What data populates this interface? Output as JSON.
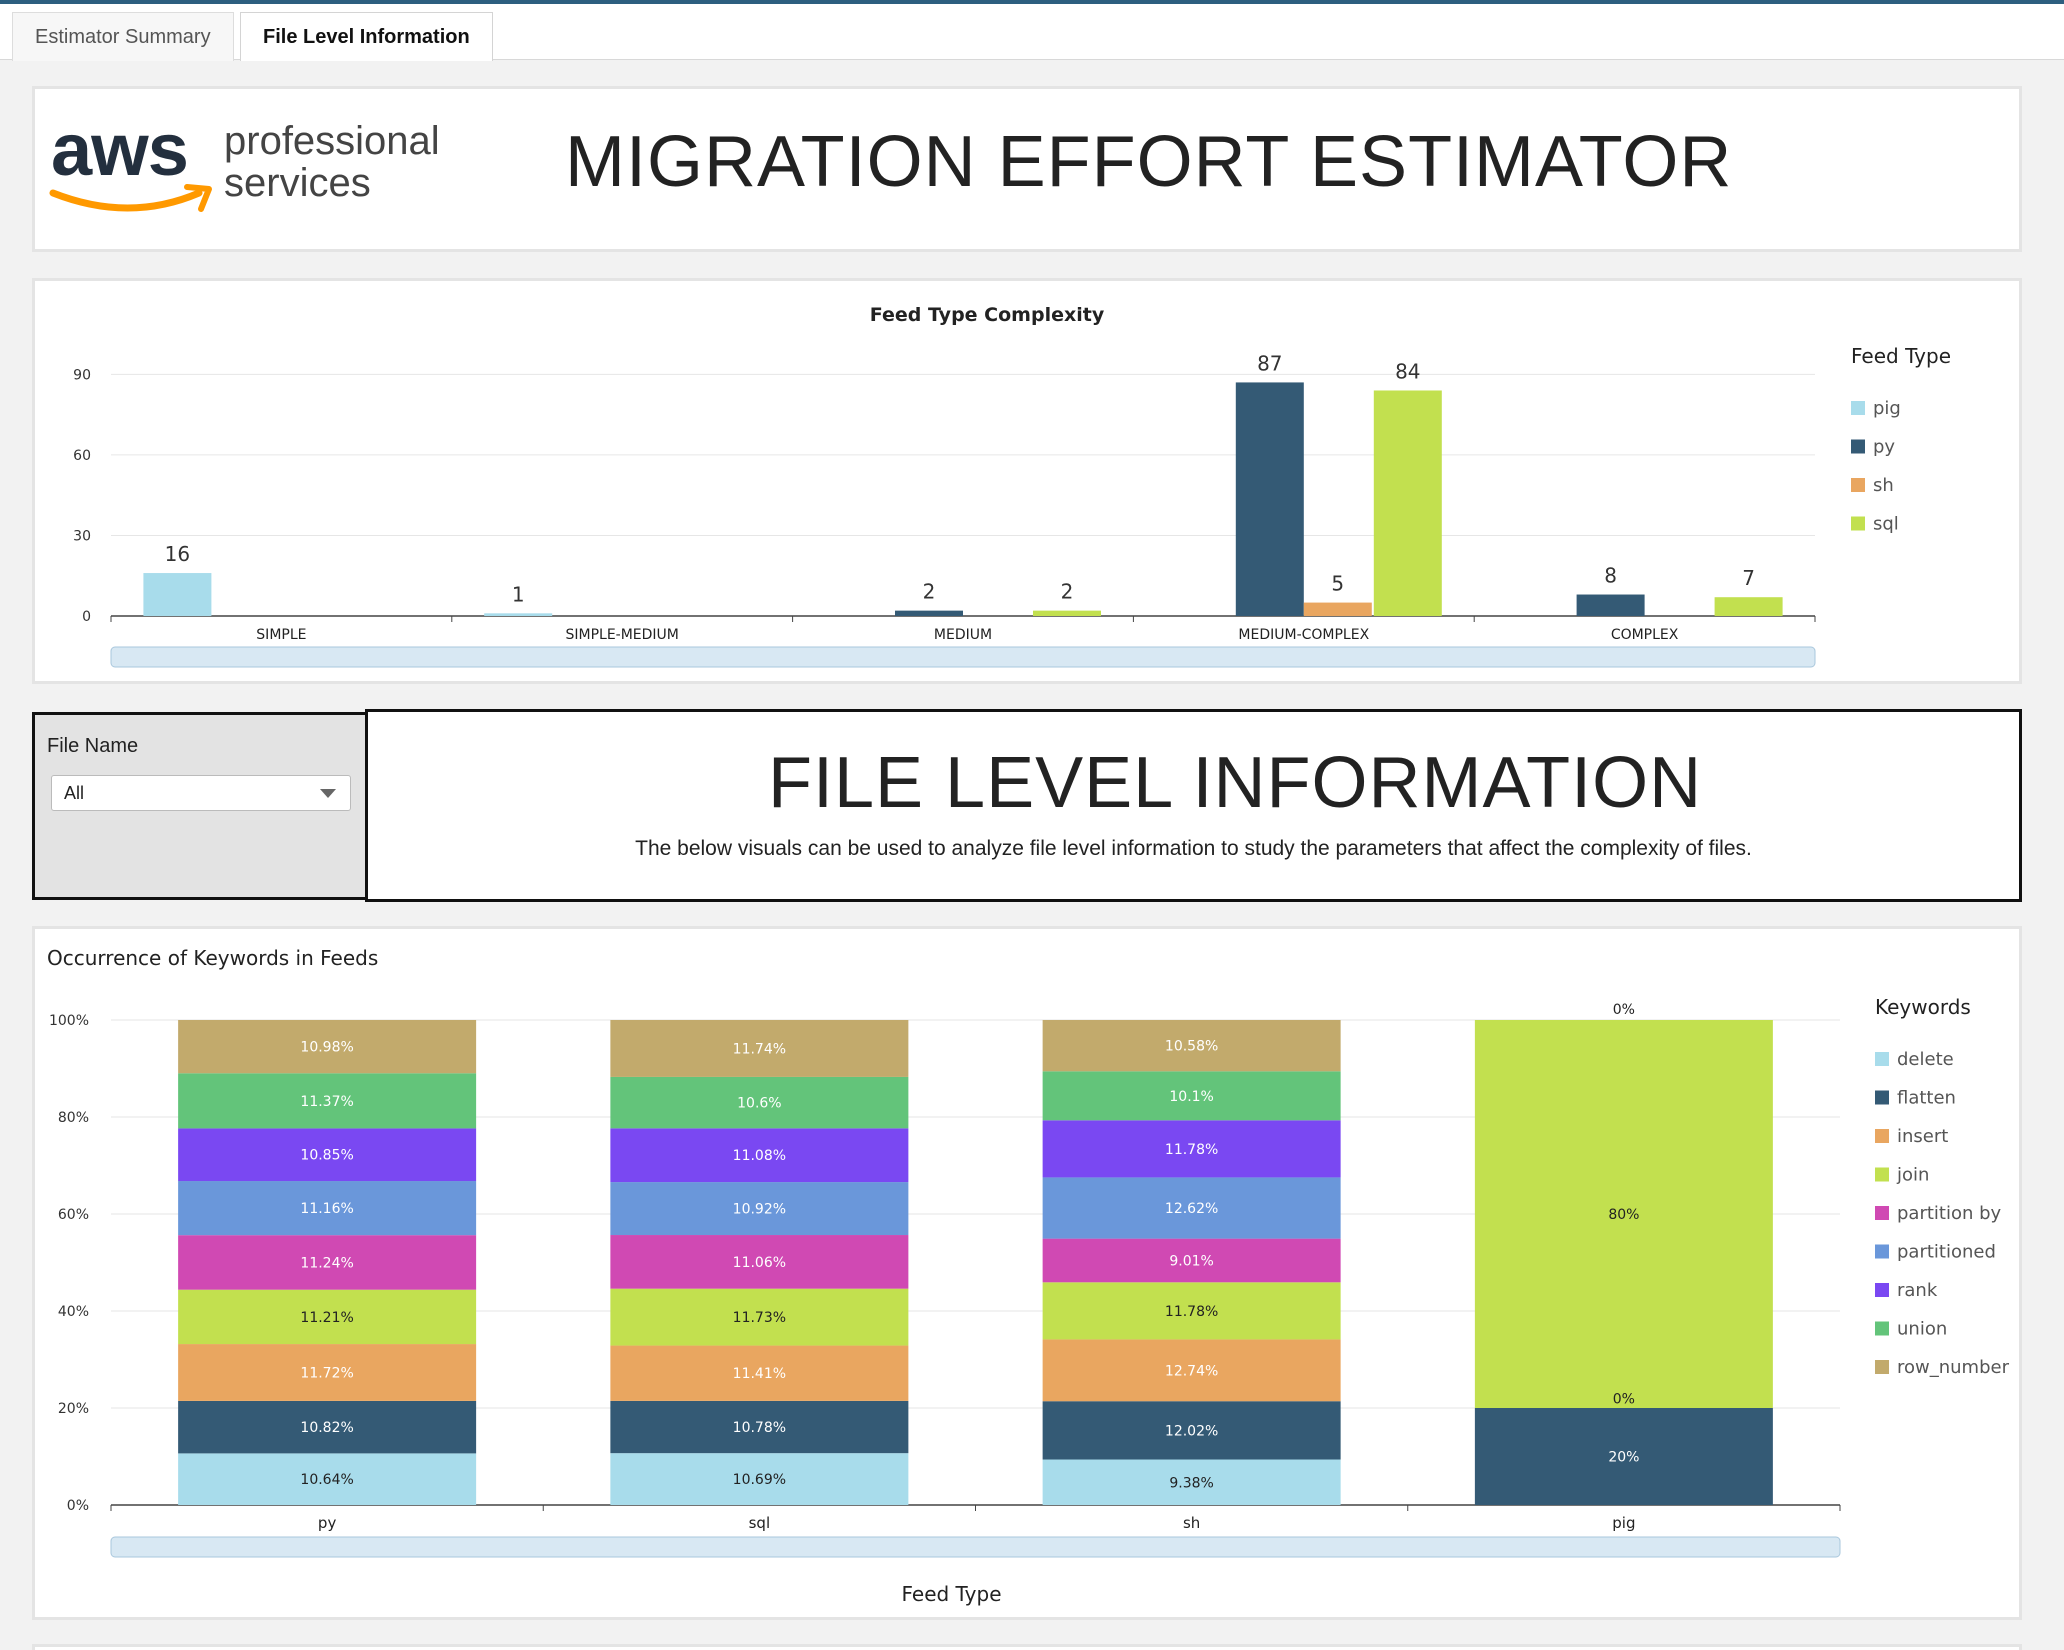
{
  "tabs": [
    {
      "label": "Estimator Summary"
    },
    {
      "label": "File Level Information"
    }
  ],
  "header": {
    "logo_aws": "aws",
    "logo_line1": "professional",
    "logo_line2": "services",
    "title": "MIGRATION EFFORT ESTIMATOR"
  },
  "filter": {
    "label": "File Name",
    "value": "All"
  },
  "info": {
    "title": "FILE LEVEL INFORMATION",
    "description": "The below visuals can be used to analyze file level information to study the parameters that affect the complexity of files."
  },
  "colors": {
    "delete": "#a8dceb",
    "flatten": "#345a75",
    "insert": "#e9a660",
    "join": "#c2e04f",
    "partition by": "#d049b3",
    "partitioned": "#6a97da",
    "rank": "#7a48f2",
    "union": "#63c47a",
    "row_number": "#c2aa6c"
  },
  "chart_data": [
    {
      "type": "bar",
      "title": "Feed Type Complexity",
      "legend_title": "Feed Type",
      "legend_position": "right",
      "categories": [
        "SIMPLE",
        "SIMPLE-MEDIUM",
        "MEDIUM",
        "MEDIUM-COMPLEX",
        "COMPLEX"
      ],
      "series": [
        {
          "name": "pig",
          "color": "#a8dceb",
          "values": [
            16,
            1,
            null,
            null,
            null
          ]
        },
        {
          "name": "py",
          "color": "#345a75",
          "values": [
            null,
            null,
            2,
            87,
            8
          ]
        },
        {
          "name": "sh",
          "color": "#e9a660",
          "values": [
            null,
            null,
            null,
            5,
            null
          ]
        },
        {
          "name": "sql",
          "color": "#c2e04f",
          "values": [
            null,
            null,
            2,
            84,
            7
          ]
        }
      ],
      "yticks": [
        0,
        30,
        60,
        90
      ],
      "ylim": [
        0,
        92
      ],
      "grid": true
    },
    {
      "type": "bar",
      "stacked": "percent",
      "title": "Occurrence of Keywords in Feeds",
      "xlabel": "Feed Type",
      "legend_title": "Keywords",
      "legend_position": "right",
      "categories": [
        "py",
        "sql",
        "sh",
        "pig"
      ],
      "yticks": [
        "0%",
        "20%",
        "40%",
        "60%",
        "80%",
        "100%"
      ],
      "series": [
        {
          "name": "delete",
          "values": [
            10.64,
            10.69,
            9.38,
            0
          ],
          "labels": [
            "10.64%",
            "10.69%",
            "9.38%",
            "0%"
          ]
        },
        {
          "name": "flatten",
          "values": [
            10.82,
            10.78,
            12.02,
            20
          ],
          "labels": [
            "10.82%",
            "10.78%",
            "12.02%",
            "20%"
          ]
        },
        {
          "name": "insert",
          "values": [
            11.72,
            11.41,
            12.74,
            0
          ],
          "labels": [
            "11.72%",
            "11.41%",
            "12.74%",
            ""
          ]
        },
        {
          "name": "join",
          "values": [
            11.21,
            11.73,
            11.78,
            80
          ],
          "labels": [
            "11.21%",
            "11.73%",
            "11.78%",
            "80%"
          ]
        },
        {
          "name": "partition by",
          "values": [
            11.24,
            11.06,
            9.01,
            0
          ],
          "labels": [
            "11.24%",
            "11.06%",
            "9.01%",
            ""
          ]
        },
        {
          "name": "partitioned",
          "values": [
            11.16,
            10.92,
            12.62,
            0
          ],
          "labels": [
            "11.16%",
            "10.92%",
            "12.62%",
            ""
          ]
        },
        {
          "name": "rank",
          "values": [
            10.85,
            11.08,
            11.78,
            0
          ],
          "labels": [
            "10.85%",
            "11.08%",
            "11.78%",
            ""
          ]
        },
        {
          "name": "union",
          "values": [
            11.37,
            10.6,
            10.1,
            0
          ],
          "labels": [
            "11.37%",
            "10.6%",
            "10.1%",
            ""
          ]
        },
        {
          "name": "row_number",
          "values": [
            10.98,
            11.74,
            10.58,
            0
          ],
          "labels": [
            "10.98%",
            "11.74%",
            "10.58%",
            "0%"
          ]
        }
      ],
      "extra_labels": [
        {
          "category": "pig",
          "text": "0%",
          "at_percent": 20.3
        }
      ],
      "grid": true
    }
  ]
}
